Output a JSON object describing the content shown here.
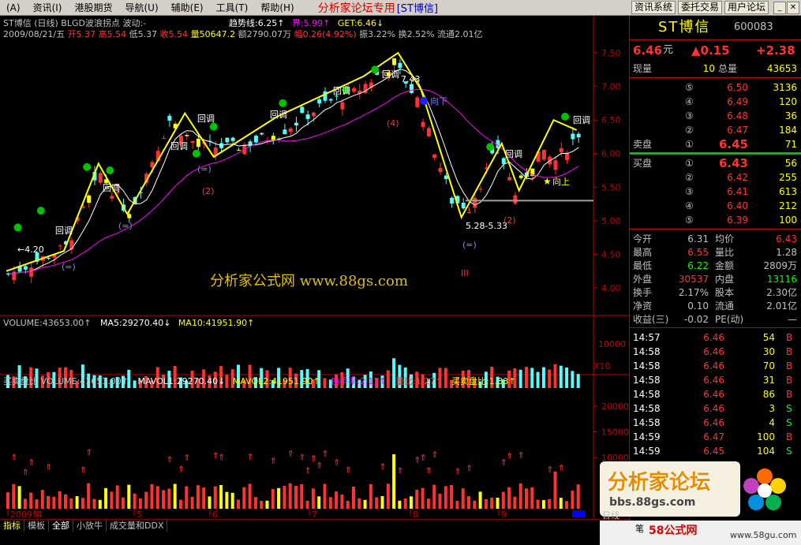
{
  "menu": {
    "items": [
      "(A)",
      "资讯(I)",
      "港股期货",
      "导航(U)",
      "辅助(E)",
      "工具(T)",
      "帮助(H)"
    ],
    "title": "分析家论坛专用",
    "stock": "[ST博信]",
    "buttons": [
      "资讯系统",
      "委托交易",
      "用户论坛"
    ]
  },
  "chart": {
    "line1": {
      "name": "ST博信 (日线) BLGD波浪拐点 波动:-",
      "trend": "趋势线:6.25↑",
      "jie": "界:5.99↑",
      "get": "GET:6.46↓"
    },
    "line2": {
      "date": "2009/08/21/五",
      "kai": "开5.37",
      "gao": "高5.54",
      "di": "低5.37",
      "shou": "收5.54",
      "liang": "量50647.2",
      "e": "额2790.07万",
      "fu": "幅0.26(4.92%)",
      "zhen": "振3.22%",
      "huan": "换2.52%",
      "liutong": "流通2.01亿"
    },
    "yticks": [
      "7.50",
      "7.00",
      "6.50",
      "6.00",
      "5.50",
      "5.00",
      "4.50",
      "4.00"
    ],
    "annot": {
      "huitiao": "回调",
      "high": "7.43",
      "low": "5.28-5.33",
      "low2": "←4.20",
      "xiangxia": "向下",
      "xiangshang": "向上",
      "roman": "III",
      "m4": "(4)",
      "m2a": "(2)",
      "m2b": "(2)",
      "eq1": "(=)",
      "eq2": "(=)",
      "eq3": "(=)",
      "eq4": "(=)"
    },
    "vol": {
      "v": "VOLUME:43653.00↑",
      "ma5": "MA5:29270.40↓",
      "ma10": "MA10:41951.90↑",
      "ticks": [
        "10000"
      ],
      "x10": "X10"
    },
    "mmb": {
      "name": "买卖盘比",
      "v": "VOLUME:43653.00↑",
      "mv1": "MAVOL1:29270.40↓",
      "mv2": "MAVOL2:41951.90↑",
      "hs": "换手率:2.17↑",
      "lb": "量比:1.27↑",
      "mmb": "买卖盘比:1.83↑",
      "ticks": [
        "20000",
        "15000",
        "10000"
      ]
    },
    "xaxis": [
      "2009年",
      "4",
      "5",
      "6",
      "7",
      "8",
      "9"
    ],
    "watermark": "分析家公式网 www.88gs.com"
  },
  "panel": {
    "name": "ST博信",
    "code": "600083",
    "price": "6.46",
    "unit": "元",
    "chg": "▲0.15",
    "chgpct": "+2.38",
    "xianliang_l": "现量",
    "xianliang": "10",
    "zongliang_l": "总量",
    "zongliang": "43653",
    "sell": [
      {
        "n": "⑤",
        "p": "6.50",
        "v": "3136"
      },
      {
        "n": "④",
        "p": "6.49",
        "v": "120"
      },
      {
        "n": "③",
        "p": "6.48",
        "v": "36"
      },
      {
        "n": "②",
        "p": "6.47",
        "v": "184"
      },
      {
        "n": "①",
        "p": "6.45",
        "v": "71"
      }
    ],
    "sell_l": "卖盘",
    "buy_l": "买盘",
    "buy": [
      {
        "n": "①",
        "p": "6.43",
        "v": "56"
      },
      {
        "n": "②",
        "p": "6.42",
        "v": "255"
      },
      {
        "n": "③",
        "p": "6.41",
        "v": "613"
      },
      {
        "n": "④",
        "p": "6.40",
        "v": "212"
      },
      {
        "n": "⑤",
        "p": "6.39",
        "v": "100"
      }
    ],
    "stats": [
      [
        "今开",
        "6.31",
        "均价",
        "6.43"
      ],
      [
        "最高",
        "6.55",
        "量比",
        "1.28"
      ],
      [
        "最低",
        "6.22",
        "金额",
        "2809万"
      ],
      [
        "外盘",
        "30537",
        "内盘",
        "13116"
      ],
      [
        "换手",
        "2.17%",
        "股本",
        "2.30亿"
      ],
      [
        "净资",
        "0.10",
        "流通",
        "2.01亿"
      ],
      [
        "收益(三)",
        "-0.02",
        "PE(动)",
        "—"
      ]
    ],
    "ticks": [
      [
        "14:57",
        "6.46",
        "54",
        "B"
      ],
      [
        "14:58",
        "6.46",
        "30",
        "B"
      ],
      [
        "14:58",
        "6.46",
        "70",
        "B"
      ],
      [
        "14:58",
        "6.46",
        "31",
        "B"
      ],
      [
        "14:58",
        "6.46",
        "86",
        "B"
      ],
      [
        "14:58",
        "6.46",
        "3",
        "S"
      ],
      [
        "14:58",
        "6.46",
        "4",
        "S"
      ],
      [
        "14:59",
        "6.47",
        "100",
        "B"
      ],
      [
        "14:59",
        "6.45",
        "104",
        "S"
      ]
    ]
  },
  "tabs": [
    "指标",
    "模板",
    "全部",
    "小放牛",
    "成交量和DDX"
  ],
  "status": {
    "riji": "日线",
    "bi": "笔"
  },
  "logo": {
    "t1": "分析家论坛",
    "t2": "bbs.88gs.com",
    "t3": "58公式网",
    "t4": "www.58gu.com"
  },
  "colors": {
    "up": "#ff3232",
    "down": "#54fcfc",
    "yellow": "#ffff00",
    "magenta": "#ff00ff"
  }
}
